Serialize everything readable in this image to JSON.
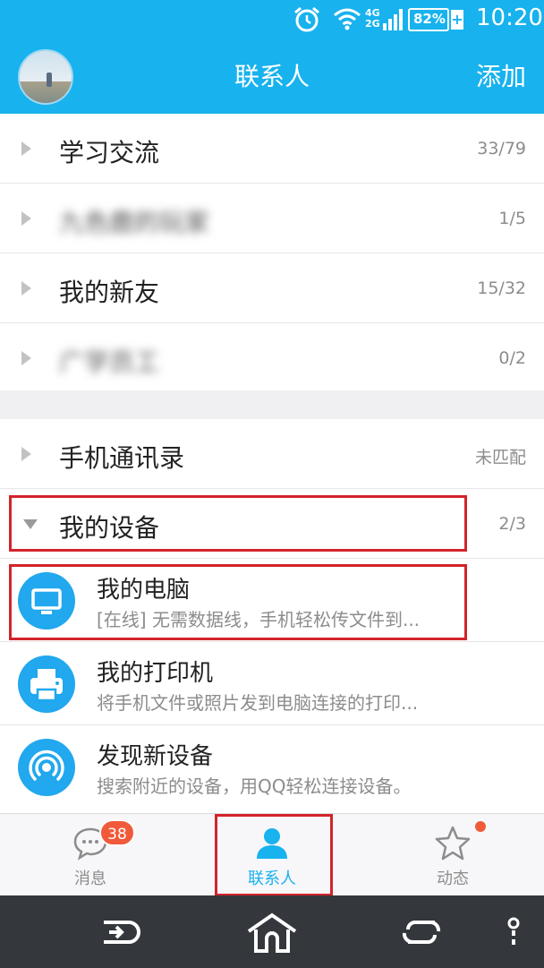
{
  "status_bar": {
    "network": "4G\n2G",
    "battery": "82%",
    "time": "10:20"
  },
  "header": {
    "title": "联系人",
    "add_label": "添加"
  },
  "groups": [
    {
      "name": "学习交流",
      "count": "33/79",
      "blurred": false
    },
    {
      "name": "九色鹿的玩家",
      "count": "1/5",
      "blurred": true
    },
    {
      "name": "我的新友",
      "count": "15/32",
      "blurred": false
    },
    {
      "name": "广学员工",
      "count": "0/2",
      "blurred": true
    }
  ],
  "address_book": {
    "name": "手机通讯录",
    "status": "未匹配"
  },
  "my_devices": {
    "name": "我的设备",
    "count": "2/3"
  },
  "devices": [
    {
      "name": "我的电脑",
      "desc": "[在线] 无需数据线，手机轻松传文件到...",
      "icon": "monitor-icon"
    },
    {
      "name": "我的打印机",
      "desc": "将手机文件或照片发到电脑连接的打印...",
      "icon": "printer-icon"
    },
    {
      "name": "发现新设备",
      "desc": "搜索附近的设备，用QQ轻松连接设备。",
      "icon": "radar-icon"
    }
  ],
  "tabs": [
    {
      "label": "消息",
      "badge": "38",
      "icon": "chat-bubble-icon"
    },
    {
      "label": "联系人",
      "icon": "person-icon",
      "active": true
    },
    {
      "label": "动态",
      "icon": "star-icon",
      "dot": true
    }
  ],
  "colors": {
    "accent": "#18b2ee",
    "highlight": "#d3232a",
    "badge": "#f05a3a"
  }
}
